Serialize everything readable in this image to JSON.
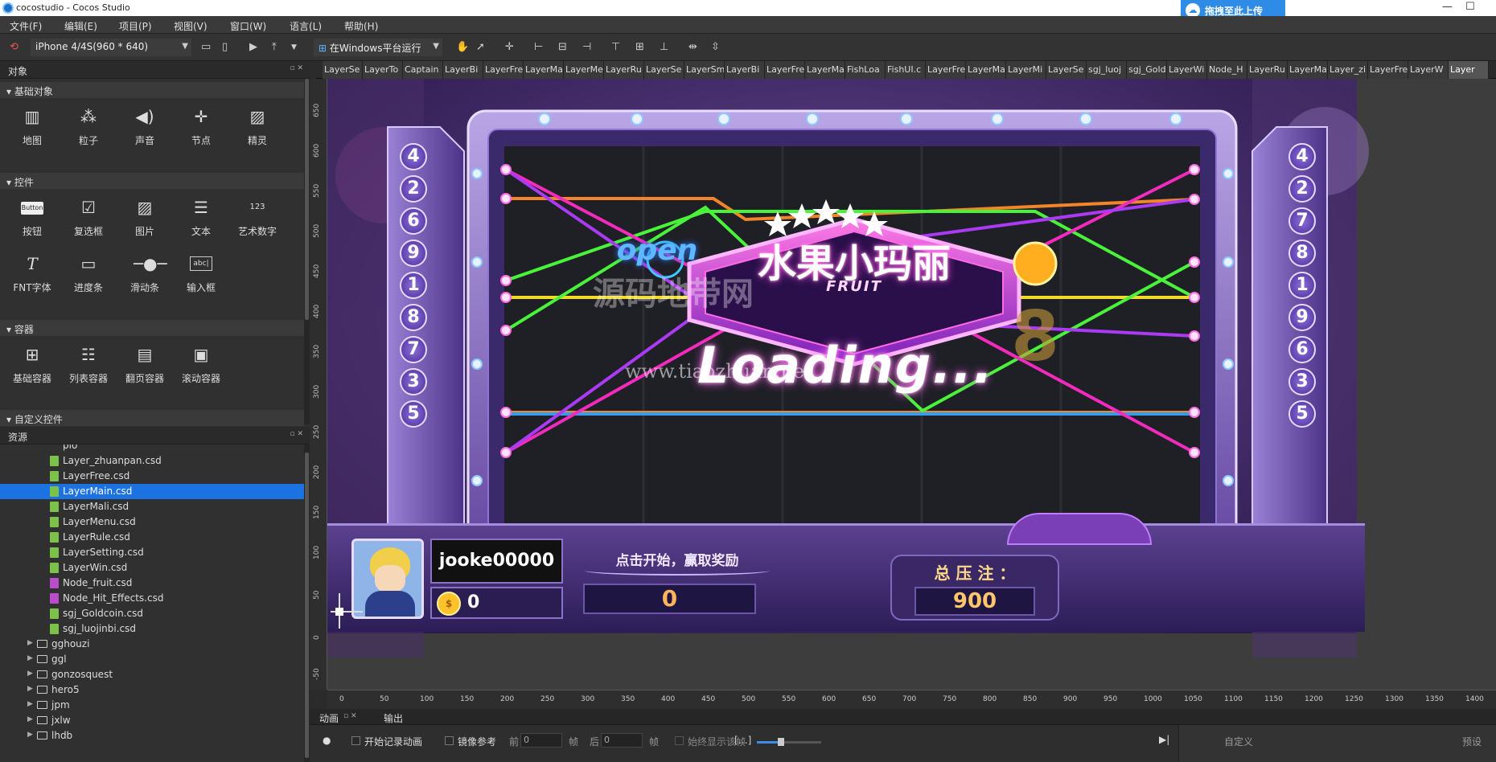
{
  "window": {
    "title": "cocostudio - Cocos Studio",
    "upload_label": "拖拽至此上传",
    "upload_icon": "cloud-icon"
  },
  "menu": [
    "文件(F)",
    "编辑(E)",
    "项目(P)",
    "视图(V)",
    "窗口(W)",
    "语言(L)",
    "帮助(H)"
  ],
  "toolbar": {
    "device": "iPhone 4/4S(960 * 640)",
    "run_mode": "在Windows平台运行"
  },
  "objects_panel": {
    "title": "对象",
    "sections": {
      "basic": {
        "title": "基础对象",
        "items": [
          {
            "label": "地图",
            "icon": "map-icon"
          },
          {
            "label": "粒子",
            "icon": "particle-icon"
          },
          {
            "label": "声音",
            "icon": "sound-icon"
          },
          {
            "label": "节点",
            "icon": "node-icon"
          },
          {
            "label": "精灵",
            "icon": "sprite-icon"
          }
        ]
      },
      "controls": {
        "title": "控件",
        "items": [
          {
            "label": "按钮",
            "icon": "button-icon",
            "glyph": "Button"
          },
          {
            "label": "复选框",
            "icon": "checkbox-icon"
          },
          {
            "label": "图片",
            "icon": "image-icon"
          },
          {
            "label": "文本",
            "icon": "text-icon"
          },
          {
            "label": "艺术数字",
            "icon": "art-number-icon",
            "glyph": "123"
          },
          {
            "label": "FNT字体",
            "icon": "fnt-font-icon"
          },
          {
            "label": "进度条",
            "icon": "progress-bar-icon"
          },
          {
            "label": "滑动条",
            "icon": "slider-icon"
          },
          {
            "label": "输入框",
            "icon": "input-box-icon",
            "glyph": "abc|"
          }
        ]
      },
      "containers": {
        "title": "容器",
        "items": [
          {
            "label": "基础容器",
            "icon": "panel-icon"
          },
          {
            "label": "列表容器",
            "icon": "list-view-icon"
          },
          {
            "label": "翻页容器",
            "icon": "page-view-icon"
          },
          {
            "label": "滚动容器",
            "icon": "scroll-view-icon"
          }
        ]
      },
      "custom": {
        "title": "自定义控件"
      }
    }
  },
  "resources_panel": {
    "title": "资源",
    "truncated_top": "plo",
    "files": [
      {
        "name": "Layer_zhuanpan.csd",
        "color": "green"
      },
      {
        "name": "LayerFree.csd",
        "color": "green"
      },
      {
        "name": "LayerMain.csd",
        "color": "green",
        "selected": true
      },
      {
        "name": "LayerMali.csd",
        "color": "green"
      },
      {
        "name": "LayerMenu.csd",
        "color": "green"
      },
      {
        "name": "LayerRule.csd",
        "color": "green"
      },
      {
        "name": "LayerSetting.csd",
        "color": "green"
      },
      {
        "name": "LayerWin.csd",
        "color": "green"
      },
      {
        "name": "Node_fruit.csd",
        "color": "purple"
      },
      {
        "name": "Node_Hit_Effects.csd",
        "color": "purple"
      },
      {
        "name": "sgj_Goldcoin.csd",
        "color": "green"
      },
      {
        "name": "sgj_luojinbi.csd",
        "color": "green"
      }
    ],
    "folders": [
      "gghouzi",
      "ggl",
      "gonzosquest",
      "hero5",
      "jpm",
      "jxlw",
      "lhdb"
    ]
  },
  "doc_tabs": [
    "LayerSe",
    "LayerTo",
    "Captain",
    "LayerBi",
    "LayerFre",
    "LayerMa",
    "LayerMe",
    "LayerRu",
    "LayerSe",
    "LayerSm",
    "LayerBi",
    "LayerFre",
    "LayerMa",
    "FishLoa",
    "FishUI.c",
    "LayerFre",
    "LayerMa",
    "LayerMi",
    "LayerSe",
    "sgj_luoj",
    "sgj_Gold",
    "LayerWi",
    "Node_H",
    "LayerRu",
    "LayerMa",
    "Layer_zi",
    "LayerFre",
    "LayerW",
    "Layer"
  ],
  "ruler_v": [
    "650",
    "600",
    "550",
    "500",
    "450",
    "400",
    "350",
    "300",
    "250",
    "200",
    "150",
    "100",
    "50",
    "0",
    "-50"
  ],
  "ruler_h": [
    "0",
    "50",
    "100",
    "150",
    "200",
    "250",
    "300",
    "350",
    "400",
    "450",
    "500",
    "550",
    "600",
    "650",
    "700",
    "750",
    "800",
    "850",
    "900",
    "950",
    "1000",
    "1050",
    "1100",
    "1150",
    "1200",
    "1250",
    "1300",
    "1350",
    "1400"
  ],
  "game": {
    "logo_cn": "水果小玛丽",
    "logo_en": "FRUIT",
    "open_sign": "open",
    "loading": "Loading...",
    "watermark_cn": "源码地带网",
    "watermark_url": "www.tiaozhuan.net",
    "left_numbers": [
      "4",
      "2",
      "6",
      "9",
      "1",
      "8",
      "7",
      "3",
      "5"
    ],
    "right_numbers": [
      "4",
      "2",
      "7",
      "8",
      "1",
      "9",
      "6",
      "3",
      "5"
    ],
    "player_name": "jooke00000",
    "coins": "0",
    "start_hint": "点击开始，赢取奖励",
    "win_value": "0",
    "total_bet_label": "总 压 注 ：",
    "total_bet_value": "900",
    "colors": {
      "bg": "#3a2464",
      "frame": "#6e4bb0",
      "orange": "#ff8a2a",
      "green": "#4cff3c",
      "yellow": "#ffe52a",
      "magenta": "#ff2cc6",
      "cyan": "#2fa6ff"
    }
  },
  "bottom_panel": {
    "tabs": [
      "动画",
      "输出"
    ],
    "record_label": "开始记录动画",
    "mirror_label": "镜像参考",
    "prev_label": "前",
    "prev_value": "0",
    "frame_unit": "帧",
    "next_label": "后",
    "next_value": "0",
    "always_show_label": "始终显示该帧",
    "custom_label": "自定义",
    "preset_label": "预设"
  }
}
